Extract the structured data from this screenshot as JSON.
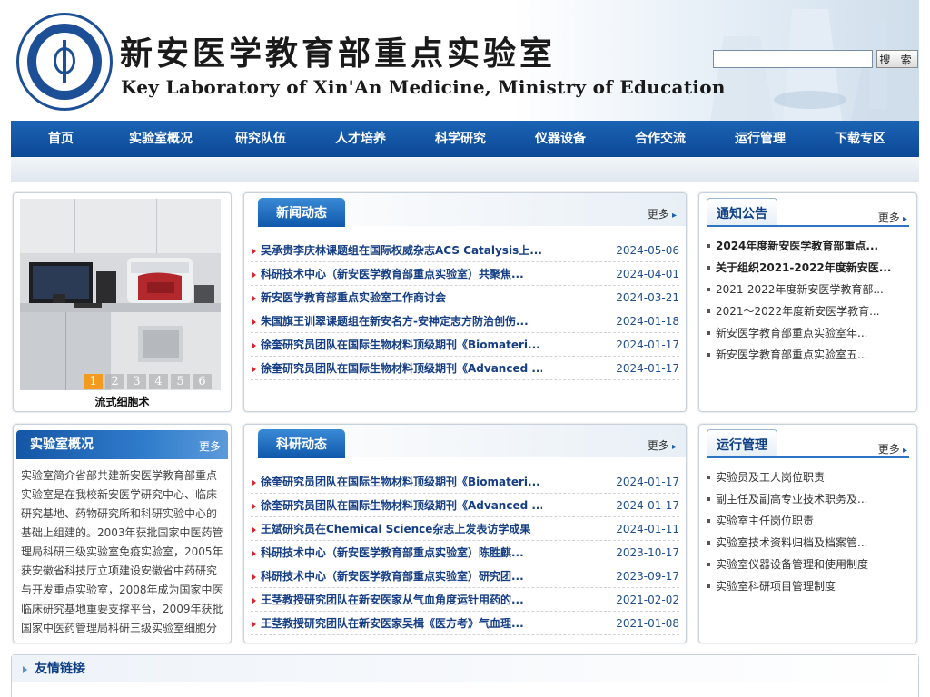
{
  "header": {
    "title_cn": "新安医学教育部重点实验室",
    "title_en": "Key Laboratory of Xin'An Medicine, Ministry of Education",
    "logo_icon": "university-emblem-icon"
  },
  "search": {
    "value": "",
    "button_label": "搜 索"
  },
  "nav": [
    "首页",
    "实验室概况",
    "研究队伍",
    "人才培养",
    "科学研究",
    "仪器设备",
    "合作交流",
    "运行管理",
    "下载专区"
  ],
  "slider": {
    "caption": "流式细胞术",
    "pages": [
      "1",
      "2",
      "3",
      "4",
      "5",
      "6"
    ],
    "active_page": 1
  },
  "news": {
    "title": "新闻动态",
    "more": "更多",
    "items": [
      {
        "title": "吴承贵李庆林课题组在国际权威杂志ACS Catalysis上...",
        "date": "2024-05-06"
      },
      {
        "title": "科研技术中心（新安医学教育部重点实验室）共聚焦...",
        "date": "2024-04-01"
      },
      {
        "title": "新安医学教育部重点实验室工作商讨会",
        "date": "2024-03-21"
      },
      {
        "title": "朱国旗王训翠课题组在新安名方-安神定志方防治创伤...",
        "date": "2024-01-18"
      },
      {
        "title": "徐奎研究员团队在国际生物材料顶级期刊《Biomateri...",
        "date": "2024-01-17"
      },
      {
        "title": "徐奎研究员团队在国际生物材料顶级期刊《Advanced ...",
        "date": "2024-01-17"
      }
    ]
  },
  "notice": {
    "title": "通知公告",
    "more": "更多",
    "items": [
      {
        "title": "2024年度新安医学教育部重点...",
        "bold": true
      },
      {
        "title": "关于组织2021-2022年度新安医...",
        "bold": true
      },
      {
        "title": "2021-2022年度新安医学教育部...",
        "bold": false
      },
      {
        "title": "2021～2022年度新安医学教育...",
        "bold": false
      },
      {
        "title": "新安医学教育部重点实验室年...",
        "bold": false
      },
      {
        "title": "新安医学教育部重点实验室五...",
        "bold": false
      }
    ]
  },
  "about": {
    "title": "实验室概况",
    "more": "更多",
    "text": "实验室简介省部共建新安医学教育部重点实验室是在我校新安医学研究中心、临床研究基地、药物研究所和科研实验中心的基础上组建的。2003年获批国家中医药管理局科研三级实验室免疫实验室，2005年获安徽省科技厅立项建设安徽省中药研究与开发重点实验室，2008年成为国家中医临床研究基地重要支撑平台，2009年获批国家中医药管理局科研三级实验室细胞分"
  },
  "sci": {
    "title": "科研动态",
    "more": "更多",
    "items": [
      {
        "title": "徐奎研究员团队在国际生物材料顶级期刊《Biomateri...",
        "date": "2024-01-17"
      },
      {
        "title": "徐奎研究员团队在国际生物材料顶级期刊《Advanced ...",
        "date": "2024-01-17"
      },
      {
        "title": "王斌研究员在Chemical Science杂志上发表访学成果",
        "date": "2024-01-11"
      },
      {
        "title": "科研技术中心（新安医学教育部重点实验室）陈胜麒...",
        "date": "2023-10-17"
      },
      {
        "title": "科研技术中心（新安医学教育部重点实验室）研究团...",
        "date": "2023-09-17"
      },
      {
        "title": "王茎教授研究团队在新安医家从气血角度运针用药的...",
        "date": "2021-02-02"
      },
      {
        "title": "王茎教授研究团队在新安医家吴楫《医方考》气血理...",
        "date": "2021-01-08"
      }
    ]
  },
  "oper": {
    "title": "运行管理",
    "more": "更多",
    "items": [
      "实验员及工人岗位职责",
      "副主任及副高专业技术职务及...",
      "实验室主任岗位职责",
      "实验室技术资料归档及档案管...",
      "实验室仪器设备管理和使用制度",
      "实验室科研项目管理制度"
    ]
  },
  "links": {
    "title": "友情链接"
  },
  "colors": {
    "nav_blue": "#0c4896",
    "link_blue": "#153e84",
    "accent_orange": "#f29b1e"
  }
}
